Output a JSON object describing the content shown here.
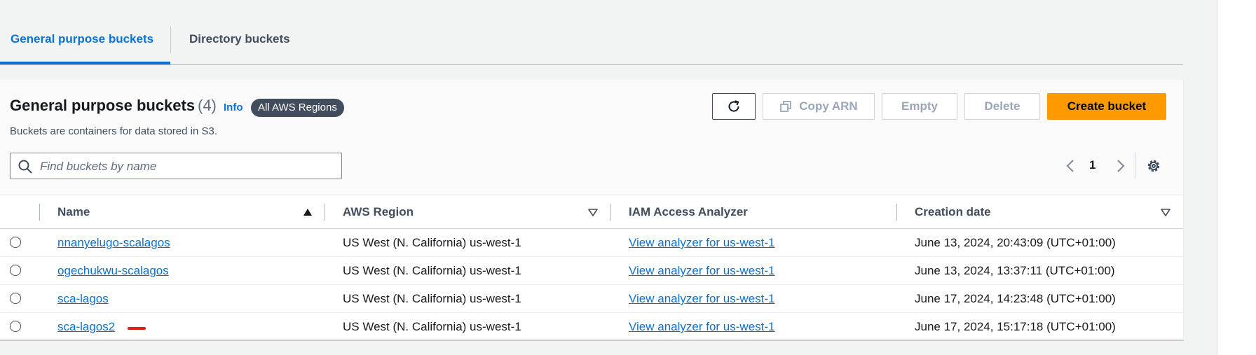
{
  "tabs": [
    {
      "label": "General purpose buckets",
      "active": true
    },
    {
      "label": "Directory buckets",
      "active": false
    }
  ],
  "panel": {
    "title": "General purpose buckets",
    "count": "(4)",
    "info": "Info",
    "region_badge": "All AWS Regions",
    "subtitle": "Buckets are containers for data stored in S3."
  },
  "actions": {
    "copy_arn": "Copy ARN",
    "empty": "Empty",
    "delete": "Delete",
    "create": "Create bucket"
  },
  "search": {
    "placeholder": "Find buckets by name",
    "value": ""
  },
  "pagination": {
    "current_page": "1"
  },
  "table": {
    "columns": [
      "Name",
      "AWS Region",
      "IAM Access Analyzer",
      "Creation date"
    ],
    "rows": [
      {
        "name": "nnanyelugo-scalagos",
        "region": "US West (N. California) us-west-1",
        "analyzer": "View analyzer for us-west-1",
        "created": "June 13, 2024, 20:43:09 (UTC+01:00)"
      },
      {
        "name": "ogechukwu-scalagos",
        "region": "US West (N. California) us-west-1",
        "analyzer": "View analyzer for us-west-1",
        "created": "June 13, 2024, 13:37:11 (UTC+01:00)"
      },
      {
        "name": "sca-lagos",
        "region": "US West (N. California) us-west-1",
        "analyzer": "View analyzer for us-west-1",
        "created": "June 17, 2024, 14:23:48 (UTC+01:00)"
      },
      {
        "name": "sca-lagos2",
        "region": "US West (N. California) us-west-1",
        "analyzer": "View analyzer for us-west-1",
        "created": "June 17, 2024, 15:17:18 (UTC+01:00)"
      }
    ]
  },
  "colors": {
    "link": "#0972d3",
    "primary_button": "#ff9900",
    "badge": "#414d5c",
    "annotation_mark": "#e01b1b"
  },
  "icons": [
    "refresh-icon",
    "copy-icon",
    "search-icon",
    "chevron-left-icon",
    "chevron-right-icon",
    "settings-icon",
    "sort-ascending-icon",
    "sort-descending-icon"
  ]
}
